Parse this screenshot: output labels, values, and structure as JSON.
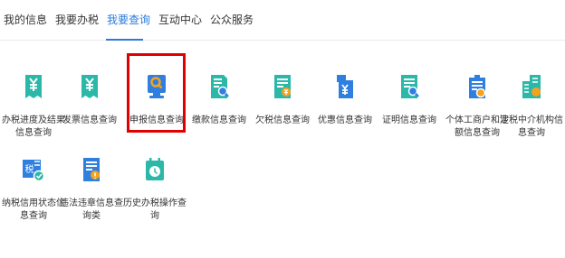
{
  "tabs": {
    "t0": "我的信息",
    "t1": "我要办税",
    "t2": "我要查询",
    "t3": "互动中心",
    "t4": "公众服务"
  },
  "items": {
    "i0": "办税进度及结果\n信息查询",
    "i1": "发票信息查询",
    "i2": "申报信息查询",
    "i3": "缴款信息查询",
    "i4": "欠税信息查询",
    "i5": "优惠信息查询",
    "i6": "证明信息查询",
    "i7": "个体工商户和定\n额信息查询",
    "i8": "涉税中介机构信\n息查询",
    "i9": "纳税信用状态信\n息查询",
    "i10": "违法违章信息查\n询类",
    "i11": "历史办税操作查\n询"
  },
  "icons": {
    "i0": "yuan-document-icon",
    "i1": "invoice-icon",
    "i2": "search-monitor-icon",
    "i3": "payment-search-icon",
    "i4": "arrears-document-icon",
    "i5": "preferential-document-icon",
    "i6": "certificate-search-icon",
    "i7": "business-search-icon",
    "i8": "building-search-icon",
    "i9": "tax-credit-icon",
    "i10": "violation-info-icon",
    "i11": "history-calendar-icon"
  },
  "colors": {
    "active_tab": "#2a7bd8",
    "icon_blue": "#2f7fe0",
    "icon_teal": "#2bb8a9",
    "icon_orange": "#f7a21b",
    "highlight_box": "#e00000"
  }
}
